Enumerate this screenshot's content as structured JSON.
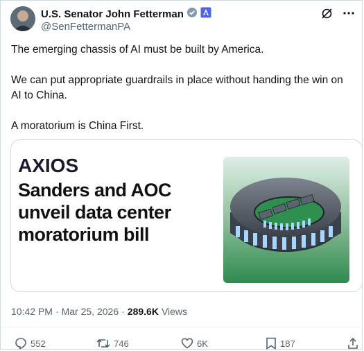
{
  "author": {
    "name": "U.S. Senator John Fetterman",
    "handle": "@SenFettermanPA"
  },
  "tweet": {
    "paragraphs": [
      "The emerging chassis of AI must be built by America.",
      "We can put appropriate guardrails in place without handing the win on AI to China.",
      "A moratorium is China First."
    ]
  },
  "card": {
    "brand": "AXIOS",
    "headline": "Sanders and AOC unveil data center moratorium bill"
  },
  "meta": {
    "time": "10:42 PM",
    "separator": "·",
    "date": "Mar 25, 2026",
    "separator2": "·",
    "views_count": "289.6K",
    "views_label": "Views"
  },
  "actions": {
    "replies": "552",
    "reposts": "746",
    "likes": "6K",
    "bookmarks": "187"
  },
  "colors": {
    "verified": "#829aab",
    "gov_badge": "#4b64e6",
    "secondary_text": "#536471"
  }
}
